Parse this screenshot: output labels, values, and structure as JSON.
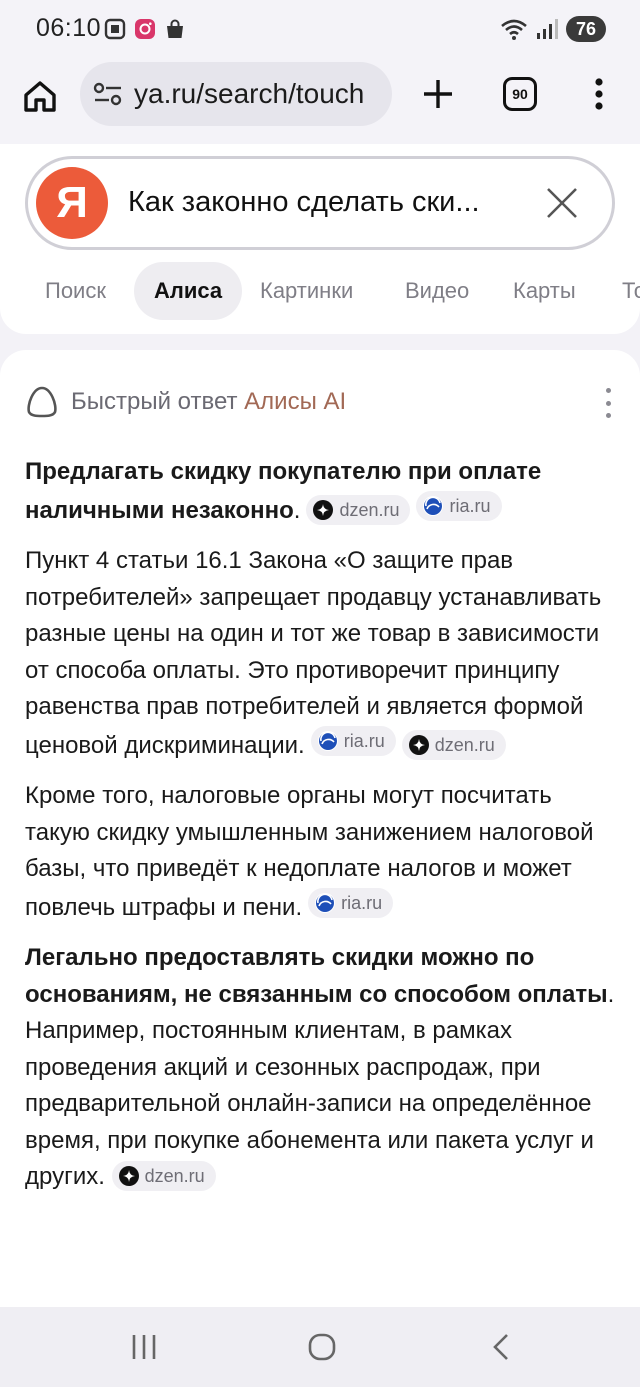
{
  "status_bar": {
    "time": "06:10",
    "battery": "76",
    "icons_left": [
      "screenshot-icon",
      "instagram-icon",
      "shopping-bag-icon"
    ],
    "icons_right": [
      "wifi-icon",
      "signal-icon",
      "battery-icon"
    ]
  },
  "browser": {
    "url": "ya.ru/search/touch",
    "tab_count": "90"
  },
  "search": {
    "logo_letter": "Я",
    "query": "Как законно сделать ски...",
    "tabs": [
      {
        "label": "Поиск",
        "active": false
      },
      {
        "label": "Алиса",
        "active": true
      },
      {
        "label": "Картинки",
        "active": false
      },
      {
        "label": "Видео",
        "active": false
      },
      {
        "label": "Карты",
        "active": false
      },
      {
        "label": "То",
        "active": false
      }
    ]
  },
  "answer": {
    "header_prefix": "Быстрый ответ ",
    "header_ai": "Алисы AI",
    "p1_bold": "Предлагать скидку покупателю при оплате наличными незаконно",
    "p1_tail": ".",
    "p1_sources": [
      "dzen.ru",
      "ria.ru"
    ],
    "p2_text": "Пункт 4 статьи 16.1 Закона «О защите прав потребителей» запрещает продавцу устанавливать разные цены на один и тот же товар в зависимости от способа оплаты. Это противоречит принципу равенства прав потребителей и является формой ценовой дискриминации.",
    "p2_sources": [
      "ria.ru",
      "dzen.ru"
    ],
    "p3_text": "Кроме того, налоговые органы могут посчитать такую скидку умышленным занижением налоговой базы, что приведёт к недоплате налогов и может повлечь штрафы и пени.",
    "p3_sources": [
      "ria.ru"
    ],
    "p4_bold": "Легально предоставлять скидки можно по основаниям, не связанным со способом оплаты",
    "p4_text": ". Например, постоянным клиентам, в рамках проведения акций и сезонных распродаж, при предварительной онлайн-записи на определённое время, при покупке абонемента или пакета услуг и других.",
    "p4_sources": [
      "dzen.ru"
    ]
  },
  "colors": {
    "yandex_red": "#ec5b3a",
    "ai_accent": "#a26955"
  }
}
